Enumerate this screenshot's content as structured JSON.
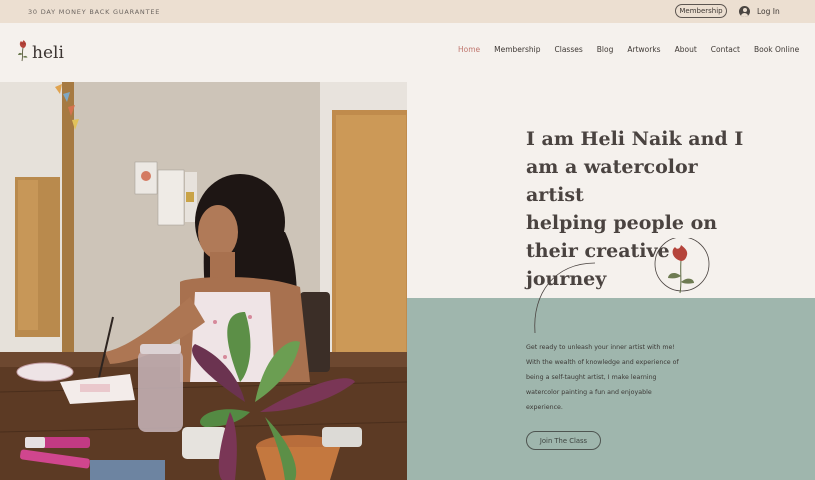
{
  "topbar": {
    "promo": "30 DAY MONEY BACK GUARANTEE",
    "membership_label": "Membership",
    "login_label": "Log In"
  },
  "header": {
    "brand": "heli",
    "nav": [
      {
        "label": "Home",
        "active": true
      },
      {
        "label": "Membership"
      },
      {
        "label": "Classes"
      },
      {
        "label": "Blog"
      },
      {
        "label": "Artworks"
      },
      {
        "label": "About"
      },
      {
        "label": "Contact"
      },
      {
        "label": "Book Online"
      }
    ]
  },
  "hero": {
    "headline_lines": [
      "I am Heli Naik and I",
      "am a watercolor artist",
      "helping people on",
      "their creative journey"
    ],
    "intro_lines": [
      "Get ready to unleash your inner artist with me!",
      "With the wealth of knowledge and experience of",
      "being a self-taught artist, I make learning",
      "watercolor painting a fun and enjoyable",
      "experience."
    ],
    "cta_label": "Join The Class"
  },
  "colors": {
    "topbar_bg": "#ecdfd1",
    "page_bg": "#f5f1ed",
    "teal_panel": "#9fb6ad",
    "nav_active": "#c0776f"
  }
}
